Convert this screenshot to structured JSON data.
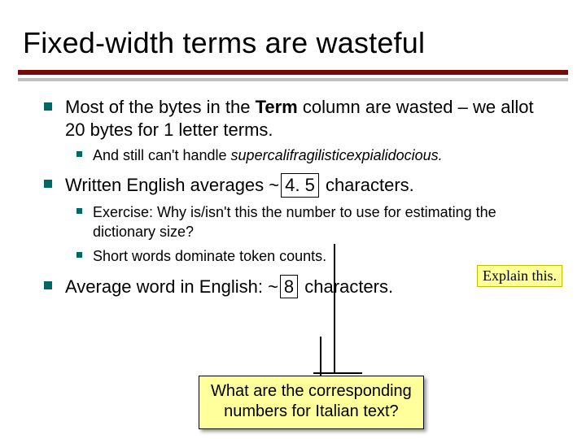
{
  "title": "Fixed-width terms are wasteful",
  "bullets": {
    "b1": {
      "pre": "Most of the bytes in the ",
      "term_word": "Term",
      "post": " column are wasted – we allot 20 bytes for 1 letter terms.",
      "sub1_pre": "And still can't handle ",
      "sub1_italic": "supercalifragilisticexpialidocious."
    },
    "b2": {
      "pre": "Written English averages ~",
      "boxed": "4. 5",
      "post": " characters.",
      "sub1": "Exercise: Why is/isn't this the number to use for estimating the dictionary size?",
      "sub2": "Short words dominate token counts."
    },
    "b3": {
      "pre": "Average word in English: ~",
      "boxed": "8",
      "post": " characters."
    }
  },
  "callouts": {
    "right": "Explain this.",
    "bottom_l1": "What are the corresponding",
    "bottom_l2": "numbers for Italian text?"
  }
}
